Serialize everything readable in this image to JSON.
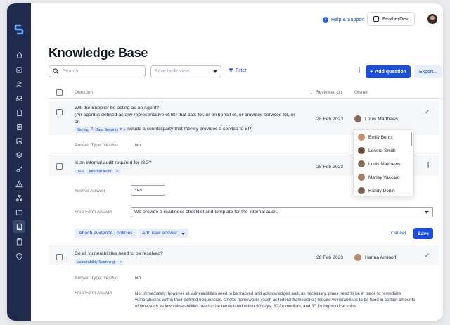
{
  "header": {
    "help_label": "Help & Support",
    "org_name": "FeatherDev"
  },
  "page": {
    "title": "Knowledge Base"
  },
  "toolbar": {
    "search_placeholder": "Search...",
    "save_view_placeholder": "Save table view...",
    "filter_label": "Filter",
    "add_question_label": "Add question",
    "export_label": "Export..."
  },
  "table": {
    "columns": {
      "question": "Question",
      "reviewed_on": "Reviewed on",
      "owner": "Owner"
    }
  },
  "rows": [
    {
      "question": "Will the Supplier be acting as an Agent?",
      "detail_1": "(An agent is defined as any representative of BP that acts for, or on behalf of, or provides services for, or on",
      "detail_2": "behalf of BP. It does not include a counterparty that merely provides a service to BP)",
      "tags": [
        "Backup",
        "Data Security"
      ],
      "reviewed_on": "28 Feb 2023",
      "owner": "Louis Matthews",
      "answer_type_label": "Answer Type: Yes/No",
      "answer_value": "No"
    },
    {
      "question": "Is an internal audit required for ISO?",
      "tags": [
        "ISO",
        "Internal audit"
      ],
      "reviewed_on": "28 Feb 2023",
      "yesno_label": "Yes/No Answer",
      "yesno_value": "Yes",
      "freeform_label": "Free Form Answer",
      "freeform_value": "We provide a readiness checklist and template for the internal audit.",
      "attach_label": "Attach evidence / policies",
      "add_answer_label": "Add new answer",
      "cancel_label": "Cancel",
      "save_label": "Save"
    },
    {
      "question": "Do all vulnerabilities need to be resolved?",
      "tags": [
        "Vulnerability Scanning"
      ],
      "reviewed_on": "28 Feb 2023",
      "owner": "Hanna Aminoff",
      "answer_type_label": "Answer Type: Yes/No",
      "answer_value": "No",
      "freeform_label": "Free Form Answer",
      "freeform_1": "Not immediately, however all vulnerabilities need to be tracked and acknowledged and, as necessary, plans need to be in place to remediate",
      "freeform_2": "vulnerabilities within their defined frequencies. stricter frameworks (such as federal frameworks) require vulnerabilities to be fixed in certain amounts",
      "freeform_3": "of time such as low vulnerabilities need to be remediated within 90 days, 60 for medium, and 30 for high/critical vulns."
    }
  ],
  "owner_dropdown": [
    "Emily Burns",
    "Lenora Smith",
    "Louis Matthews",
    "Marley Vaccaro",
    "Randy Donin"
  ],
  "colors": {
    "sidebar": "#1f2a4d",
    "accent": "#1d4ed8",
    "tag_bg": "#e3ebfa"
  }
}
